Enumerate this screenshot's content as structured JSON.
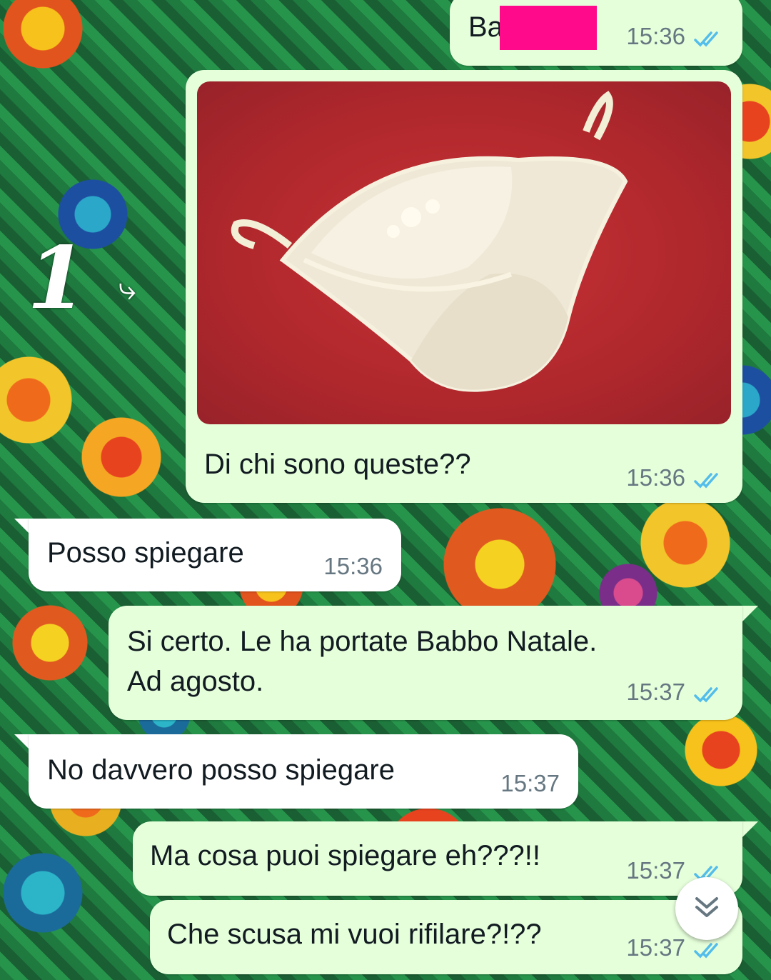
{
  "messages": [
    {
      "id": "m1",
      "direction": "out",
      "text": "Ba",
      "redacted": true,
      "time": "15:36",
      "status": "read"
    },
    {
      "id": "m2",
      "direction": "out",
      "has_photo": true,
      "photo_description_icon": "lingerie-photo",
      "text": "Di chi sono queste??",
      "time": "15:36",
      "status": "read"
    },
    {
      "id": "m3",
      "direction": "in",
      "text": "Posso spiegare",
      "time": "15:36"
    },
    {
      "id": "m4",
      "direction": "out",
      "text": "Si certo. Le ha portate Babbo Natale.\nAd agosto.",
      "time": "15:37",
      "status": "read"
    },
    {
      "id": "m5",
      "direction": "in",
      "text": "No davvero posso spiegare",
      "time": "15:37"
    },
    {
      "id": "m6",
      "direction": "out",
      "text": "Ma cosa puoi spiegare eh???!!",
      "time": "15:37",
      "status": "read"
    },
    {
      "id": "m7",
      "direction": "out",
      "text": "Che scusa mi vuoi rifilare?!??",
      "time": "15:37",
      "status": "read"
    }
  ],
  "annotation": {
    "number": "1",
    "arrow_icon": "curved-arrow-icon"
  },
  "scroll_button": {
    "icon": "double-chevron-down-icon"
  },
  "colors": {
    "outgoing_bubble": "#e6ffdb",
    "incoming_bubble": "#ffffff",
    "read_ticks": "#53bdeb",
    "timestamp": "#667781",
    "redaction": "#ff0a8a"
  }
}
